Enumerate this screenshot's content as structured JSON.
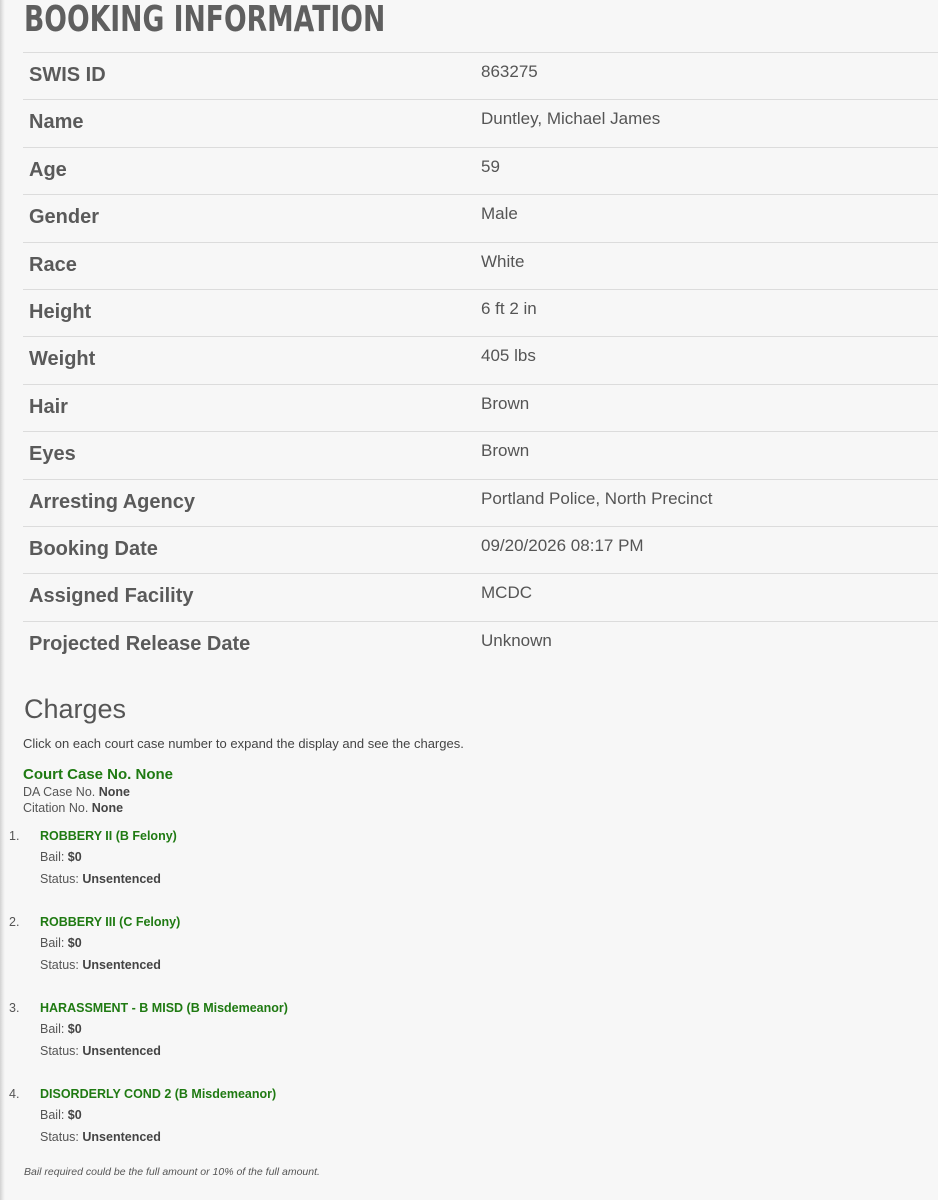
{
  "page": {
    "title": "Booking Information"
  },
  "booking": [
    {
      "label": "SWIS ID",
      "value": "863275"
    },
    {
      "label": "Name",
      "value": "Duntley, Michael James"
    },
    {
      "label": "Age",
      "value": "59"
    },
    {
      "label": "Gender",
      "value": "Male"
    },
    {
      "label": "Race",
      "value": "White"
    },
    {
      "label": "Height",
      "value": "6 ft 2 in"
    },
    {
      "label": "Weight",
      "value": "405 lbs"
    },
    {
      "label": "Hair",
      "value": "Brown"
    },
    {
      "label": "Eyes",
      "value": "Brown"
    },
    {
      "label": "Arresting Agency",
      "value": "Portland Police, North Precinct"
    },
    {
      "label": "Booking Date",
      "value": "09/20/2026 08:17 PM"
    },
    {
      "label": "Assigned Facility",
      "value": "MCDC"
    },
    {
      "label": "Projected Release Date",
      "value": "Unknown"
    }
  ],
  "charges": {
    "heading": "Charges",
    "intro": "Click on each court case number to expand the display and see the charges.",
    "case": {
      "court_case_label": "Court Case No. ",
      "court_case_value": "None",
      "da_case_label": "DA Case No. ",
      "da_case_value": "None",
      "citation_label": "Citation No. ",
      "citation_value": "None"
    },
    "bail_label": "Bail: ",
    "status_label": "Status: ",
    "items": [
      {
        "num": "1.",
        "title": "ROBBERY II (B Felony)",
        "bail": "$0",
        "status": "Unsentenced"
      },
      {
        "num": "2.",
        "title": "ROBBERY III (C Felony)",
        "bail": "$0",
        "status": "Unsentenced"
      },
      {
        "num": "3.",
        "title": "HARASSMENT - B MISD (B Misdemeanor)",
        "bail": "$0",
        "status": "Unsentenced"
      },
      {
        "num": "4.",
        "title": "DISORDERLY COND 2 (B Misdemeanor)",
        "bail": "$0",
        "status": "Unsentenced"
      }
    ],
    "footnote": "Bail required could be the full amount or 10% of the full amount."
  },
  "colors": {
    "charge_link": "#1f7a12",
    "text": "#555555",
    "background": "#f7f7f7",
    "divider": "#dcdcdc"
  }
}
